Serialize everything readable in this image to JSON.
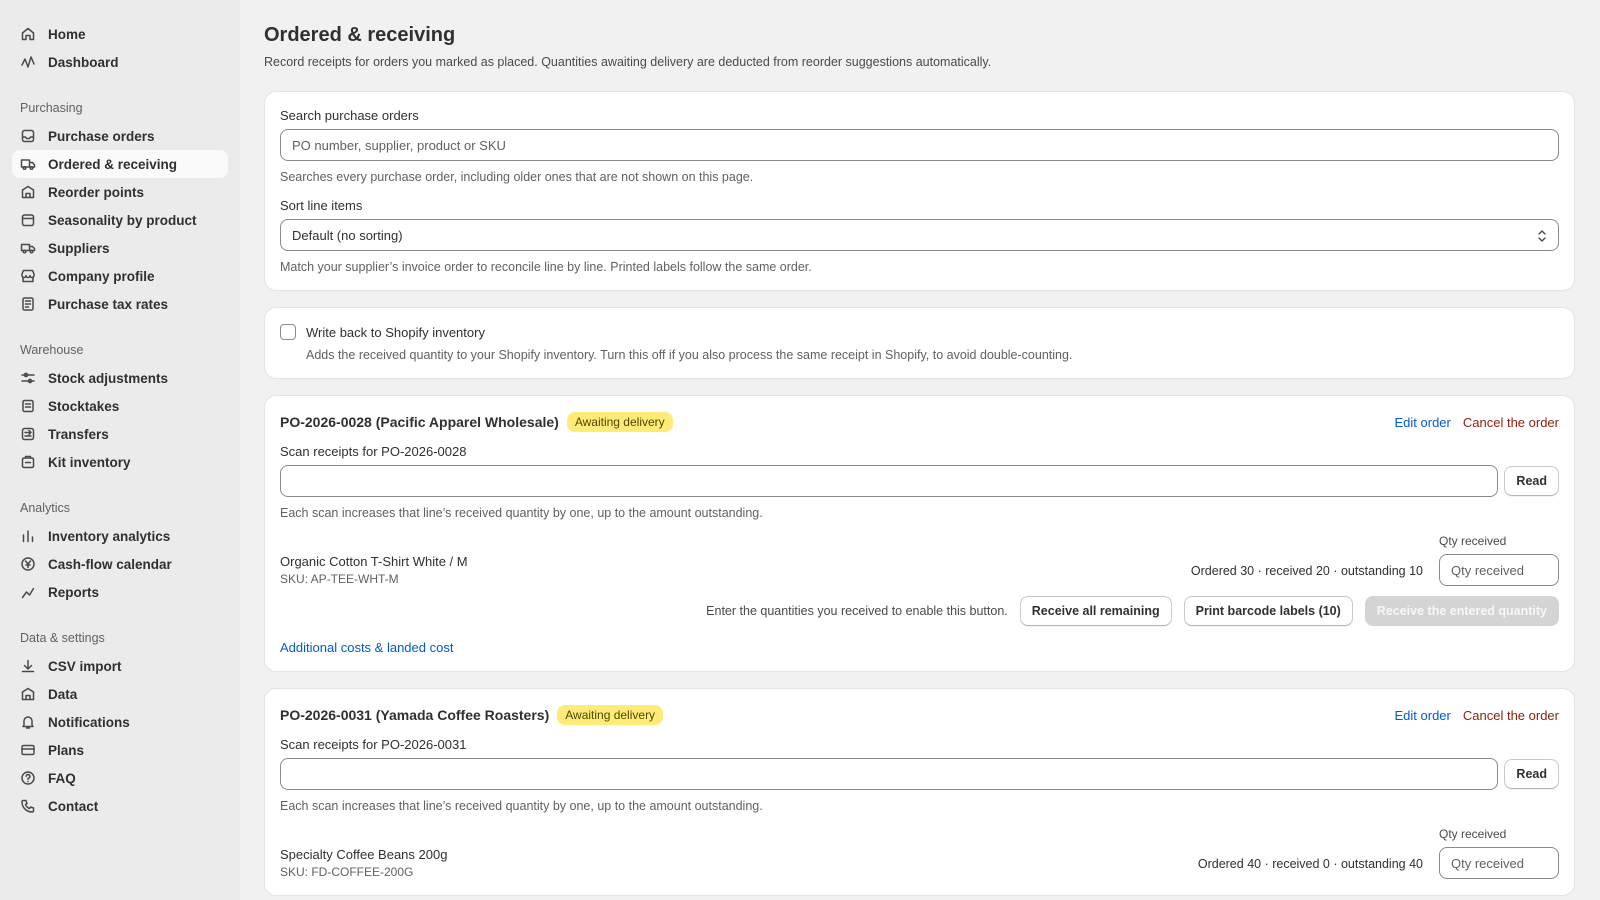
{
  "sidebar": {
    "top": [
      {
        "label": "Home",
        "icon": "home-icon"
      },
      {
        "label": "Dashboard",
        "icon": "activity-icon"
      }
    ],
    "groups": [
      {
        "heading": "Purchasing",
        "items": [
          {
            "label": "Purchase orders",
            "icon": "inbox-icon"
          },
          {
            "label": "Ordered & receiving",
            "icon": "truck-icon"
          },
          {
            "label": "Reorder points",
            "icon": "house-icon"
          },
          {
            "label": "Seasonality by product",
            "icon": "calendar-icon"
          },
          {
            "label": "Suppliers",
            "icon": "delivery-icon"
          },
          {
            "label": "Company profile",
            "icon": "store-icon"
          },
          {
            "label": "Purchase tax rates",
            "icon": "receipt-icon"
          }
        ]
      },
      {
        "heading": "Warehouse",
        "items": [
          {
            "label": "Stock adjustments",
            "icon": "sliders-icon"
          },
          {
            "label": "Stocktakes",
            "icon": "clipboard-icon"
          },
          {
            "label": "Transfers",
            "icon": "transfer-icon"
          },
          {
            "label": "Kit inventory",
            "icon": "kit-icon"
          }
        ]
      },
      {
        "heading": "Analytics",
        "items": [
          {
            "label": "Inventory analytics",
            "icon": "bar-chart-icon"
          },
          {
            "label": "Cash-flow calendar",
            "icon": "yen-icon"
          },
          {
            "label": "Reports",
            "icon": "reports-icon"
          }
        ]
      },
      {
        "heading": "Data & settings",
        "items": [
          {
            "label": "CSV import",
            "icon": "download-icon"
          },
          {
            "label": "Data",
            "icon": "database-icon"
          },
          {
            "label": "Notifications",
            "icon": "bell-icon"
          },
          {
            "label": "Plans",
            "icon": "credit-card-icon"
          },
          {
            "label": "FAQ",
            "icon": "question-icon"
          },
          {
            "label": "Contact",
            "icon": "phone-icon"
          }
        ]
      }
    ]
  },
  "page": {
    "title": "Ordered & receiving",
    "subtitle": "Record receipts for orders you marked as placed. Quantities awaiting delivery are deducted from reorder suggestions automatically."
  },
  "search_card": {
    "search_label": "Search purchase orders",
    "search_placeholder": "PO number, supplier, product or SKU",
    "search_help": "Searches every purchase order, including older ones that are not shown on this page.",
    "sort_label": "Sort line items",
    "sort_value": "Default (no sorting)",
    "sort_help": "Match your supplier’s invoice order to reconcile line by line. Printed labels follow the same order."
  },
  "writeback": {
    "label": "Write back to Shopify inventory",
    "help": "Adds the received quantity to your Shopify inventory. Turn this off if you also process the same receipt in Shopify, to avoid double-counting."
  },
  "orders": [
    {
      "title": "PO-2026-0028 (Pacific Apparel Wholesale)",
      "badge": "Awaiting delivery",
      "edit": "Edit order",
      "cancel": "Cancel the order",
      "scan_label": "Scan receipts for PO-2026-0028",
      "read": "Read",
      "scan_help": "Each scan increases that line’s received quantity by one, up to the amount outstanding.",
      "line": {
        "name": "Organic Cotton T-Shirt White / M",
        "sku": "SKU: AP-TEE-WHT-M",
        "summary": "Ordered 30 · received 20 · outstanding 10",
        "qty_label": "Qty received",
        "qty_placeholder": "Qty received"
      },
      "hint": "Enter the quantities you received to enable this button.",
      "receive_all": "Receive all remaining",
      "print_labels": "Print barcode labels (10)",
      "receive_entered": "Receive the entered quantity",
      "additional_costs": "Additional costs & landed cost"
    },
    {
      "title": "PO-2026-0031 (Yamada Coffee Roasters)",
      "badge": "Awaiting delivery",
      "edit": "Edit order",
      "cancel": "Cancel the order",
      "scan_label": "Scan receipts for PO-2026-0031",
      "read": "Read",
      "scan_help": "Each scan increases that line’s received quantity by one, up to the amount outstanding.",
      "line": {
        "name": "Specialty Coffee Beans 200g",
        "sku": "SKU: FD-COFFEE-200G",
        "summary": "Ordered 40 · received 0 · outstanding 40",
        "qty_label": "Qty received",
        "qty_placeholder": "Qty received"
      }
    }
  ],
  "colors": {
    "link": "#005bd3",
    "critical": "#8e1f0b",
    "badge_bg": "#ffeb78"
  }
}
